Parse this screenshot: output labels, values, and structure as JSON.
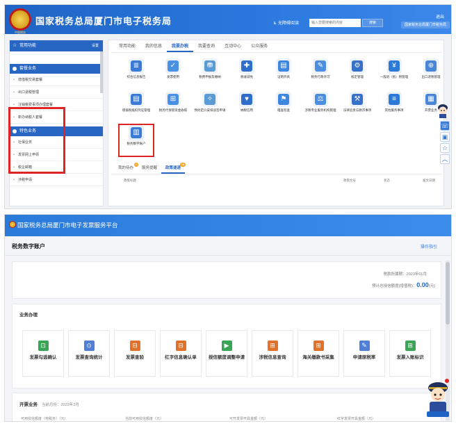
{
  "top": {
    "title": "国家税务总局厦门市电子税务局",
    "emblem_caption": "中国税务",
    "accessibility": "无障碍阅读",
    "search_placeholder": "输入您要搜索的内容",
    "search_button": "搜索",
    "logout": "退出",
    "org_name": "国家税务总局厦门市税务局",
    "sidebar": {
      "header": "常用功能",
      "settings": "设置",
      "section1": "套餐业务",
      "items1": [
        "增值税交易套餐",
        "出口退税管理",
        "注销税费事项办理套餐",
        "新办纳税人套餐"
      ],
      "section2": "特色业务",
      "items2": [
        "社保业务",
        "发票网上申领",
        "税企邮箱",
        "涉税申请"
      ]
    },
    "tabs": [
      "常用功能",
      "我的信息",
      "我要办税",
      "我要查询",
      "互动中心",
      "公众服务"
    ],
    "services_row1": [
      "综合信息报告",
      "发票使用",
      "税费申报及缴纳",
      "税收减免",
      "证明开具",
      "税务行政许可",
      "核定管理",
      "一般退（抵）税管理",
      "出口退税管理"
    ],
    "services_row2": [
      "增值税抵扣凭证管理",
      "税务代保管资金收取",
      "预约定价安排谈签申请",
      "纳税信用",
      "稽查检查",
      "涉税专业服务机构管理",
      "法律追责与救济事项",
      "其他服务事项",
      "开票业务"
    ],
    "services_row3": [
      "税务数字账户"
    ],
    "sub_tabs": [
      {
        "label": "我的待办",
        "badge": "0"
      },
      {
        "label": "服务提醒",
        "badge": ""
      },
      {
        "label": "政策速递",
        "badge": "10"
      }
    ],
    "table_header": [
      "政策标题",
      "政策文号",
      "状态",
      "发文日期"
    ]
  },
  "bottom": {
    "title": "国家税务总局厦门市电子发票服务平台",
    "page_heading": "税务数字账户",
    "guide": "操作指引",
    "period": "税款所属期：2023年01月",
    "credit_label": "预计总授信额度(增值税)：",
    "credit_value": "0.00",
    "credit_unit": "(元)",
    "biz_title": "业务办理",
    "tiles": [
      "发票勾选确认",
      "发票查询统计",
      "发票查验",
      "红字信息确认单",
      "授信额度调整申请",
      "涉税信息查询",
      "海关缴款书采集",
      "申请原税率",
      "发票入账标识"
    ],
    "invoice_title": "开票业务",
    "invoice_month": "当前月份：2023年2月",
    "invoice_cols": [
      "可用授信额度（电税务）（元）",
      "当前可用授信额度（元）",
      "可开发票开具金额（元）",
      "红字发票开具金额（元）"
    ]
  }
}
